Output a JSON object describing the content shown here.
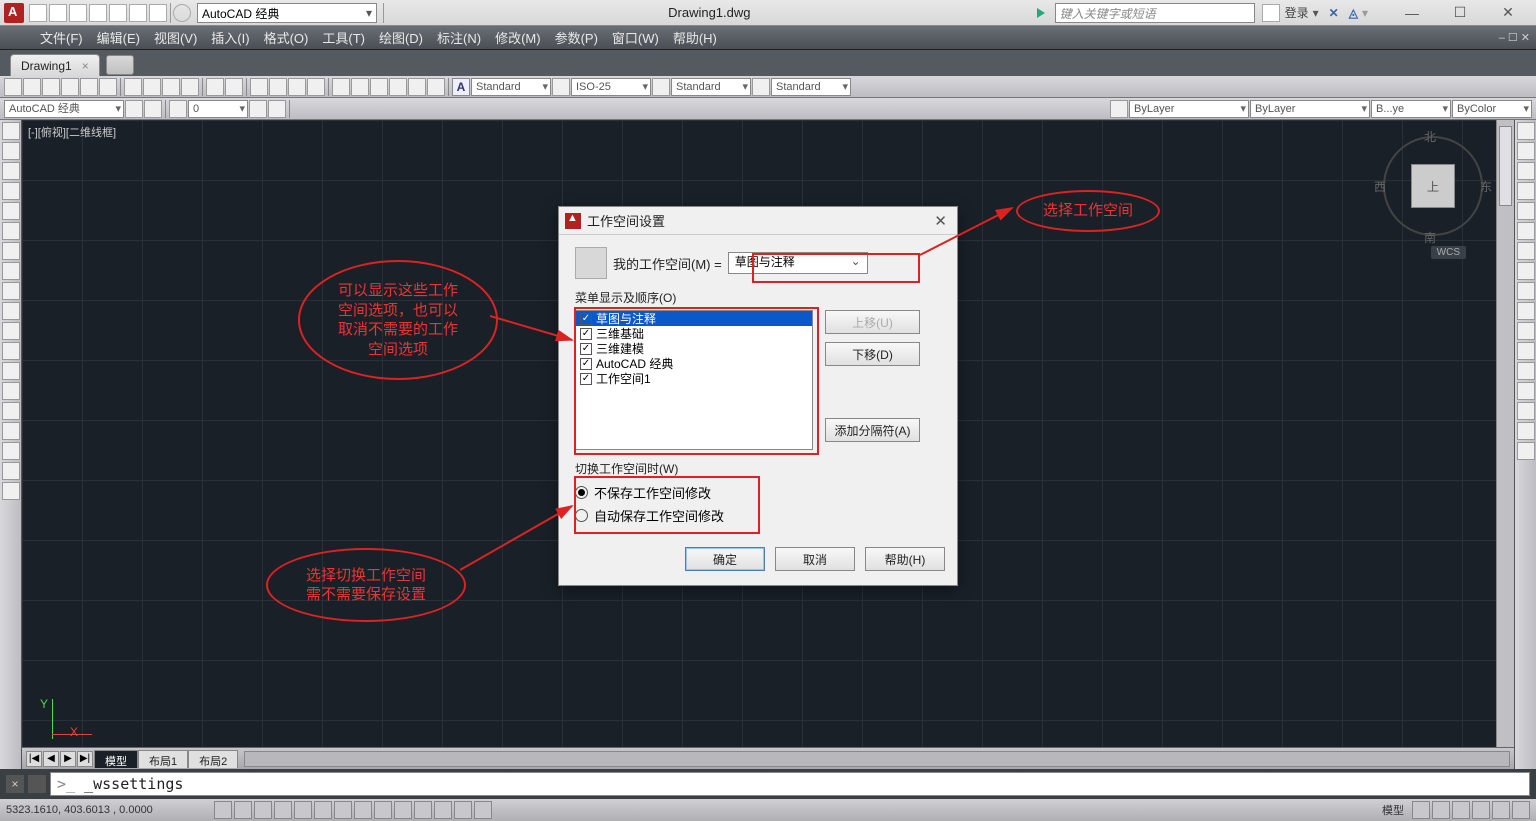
{
  "titlebar": {
    "workspace_combo": "AutoCAD 经典",
    "filename": "Drawing1.dwg",
    "search_placeholder": "键入关键字或短语",
    "login": "登录",
    "win_min": "—",
    "win_max": "☐",
    "win_close": "✕"
  },
  "menubar": {
    "items": [
      "文件(F)",
      "编辑(E)",
      "视图(V)",
      "插入(I)",
      "格式(O)",
      "工具(T)",
      "绘图(D)",
      "标注(N)",
      "修改(M)",
      "参数(P)",
      "窗口(W)",
      "帮助(H)"
    ],
    "corner": "‒ ☐ ✕"
  },
  "filetab": {
    "name": "Drawing1",
    "close": "×"
  },
  "toolbar2": {
    "text_style": "Standard",
    "dim_style": "ISO-25",
    "table_style": "Standard",
    "ml_style": "Standard"
  },
  "toolbar3": {
    "workspace": "AutoCAD 经典",
    "layer": "0",
    "layer_props": "ByLayer",
    "linetype": "ByLayer",
    "lineweight": "B...ye",
    "plot_style": "ByColor"
  },
  "canvas": {
    "viewport_label": "[-][俯视][二维线框]",
    "ucs_y": "Y",
    "ucs_x": "X",
    "viewcube": {
      "n": "北",
      "s": "南",
      "e": "东",
      "w": "西",
      "top": "上"
    },
    "wcs": "WCS"
  },
  "layout_tabs": {
    "model": "模型",
    "l1": "布局1",
    "l2": "布局2",
    "nav": [
      "|◀",
      "◀",
      "▶",
      "▶|"
    ]
  },
  "cmdline": {
    "prefix": ">_ ",
    "text": "_wssettings"
  },
  "statusbar": {
    "coords": "5323.1610, 403.6013 , 0.0000",
    "right_text": "模型"
  },
  "dialog": {
    "title": "工作空间设置",
    "my_ws_label": "我的工作空间(M)  =",
    "my_ws_value": "草图与注释",
    "list_label": "菜单显示及顺序(O)",
    "list_items": [
      "草图与注释",
      "三维基础",
      "三维建模",
      "AutoCAD 经典",
      "工作空间1"
    ],
    "btn_up": "上移(U)",
    "btn_down": "下移(D)",
    "btn_sep": "添加分隔符(A)",
    "switch_label": "切换工作空间时(W)",
    "radio1": "不保存工作空间修改",
    "radio2": "自动保存工作空间修改",
    "ok": "确定",
    "cancel": "取消",
    "help": "帮助(H)"
  },
  "annotations": {
    "a1": "可以显示这些工作\n空间选项，也可以\n取消不需要的工作\n空间选项",
    "a2": "选择切换工作空间\n需不需要保存设置",
    "a3": "选择工作空间"
  }
}
